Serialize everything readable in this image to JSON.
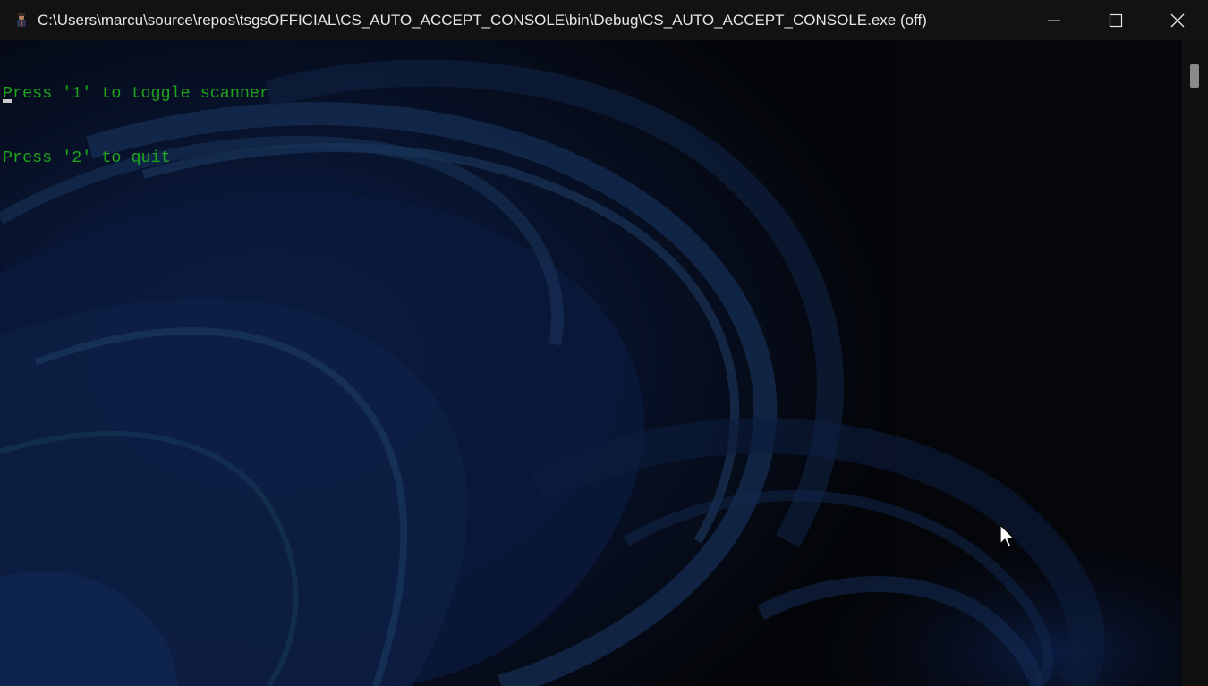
{
  "window": {
    "title": "C:\\Users\\marcu\\source\\repos\\tsgsOFFICIAL\\CS_AUTO_ACCEPT_CONSOLE\\bin\\Debug\\CS_AUTO_ACCEPT_CONSOLE.exe (off)",
    "icon": "app-user-icon",
    "controls": {
      "minimize": "minimize-icon",
      "maximize": "maximize-icon",
      "close": "close-icon"
    }
  },
  "console": {
    "lines": [
      "Press '1' to toggle scanner",
      "Press '2' to quit"
    ],
    "text_color": "#1fa51c",
    "background_color": "#0c0c0c"
  },
  "colors": {
    "titlebar": "#121212",
    "title_text": "#e6e6e6",
    "scrollbar_thumb": "#8a8a8a"
  }
}
